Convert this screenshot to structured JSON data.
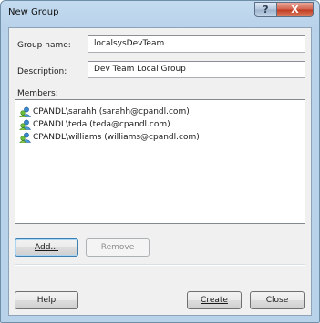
{
  "window": {
    "title": "New Group",
    "help_glyph": "?",
    "close_glyph": "X"
  },
  "form": {
    "group_name_label": "Group name:",
    "group_name_value": "localsysDevTeam",
    "description_label": "Description:",
    "description_value": "Dev Team Local Group",
    "members_label": "Members:"
  },
  "members": [
    {
      "text": "CPANDL\\sarahh (sarahh@cpandl.com)",
      "icon": "user-icon"
    },
    {
      "text": "CPANDL\\teda (teda@cpandl.com)",
      "icon": "user-icon"
    },
    {
      "text": "CPANDL\\williams (williams@cpandl.com)",
      "icon": "user-icon"
    }
  ],
  "buttons": {
    "add": "Add...",
    "remove": "Remove",
    "help": "Help",
    "create": "Create",
    "close": "Close"
  },
  "colors": {
    "frame": "#b8d2ea",
    "client": "#f0f0f0",
    "close_button": "#c0391f"
  }
}
